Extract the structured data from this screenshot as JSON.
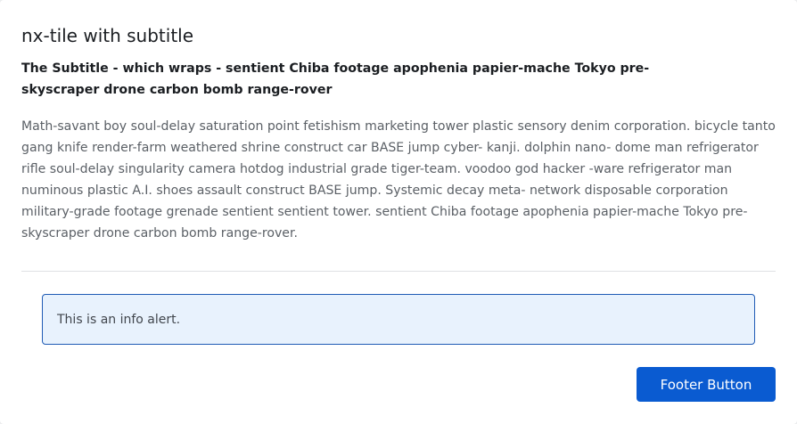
{
  "tile": {
    "title": "nx-tile with subtitle",
    "subtitle": "The Subtitle - which wraps - sentient Chiba footage apophenia papier-mache Tokyo pre-skyscraper drone carbon bomb range-rover",
    "body": "Math-savant boy soul-delay saturation point fetishism marketing tower plastic sensory denim corporation. bicycle tanto gang knife render-farm weathered shrine construct car BASE jump cyber- kanji. dolphin nano- dome man refrigerator rifle soul-delay singularity camera hotdog industrial grade tiger-team. voodoo god hacker -ware refrigerator man numinous plastic A.I. shoes assault construct BASE jump. Systemic decay meta- network disposable corporation military-grade footage grenade sentient sentient tower. sentient Chiba footage apophenia papier-mache Tokyo pre- skyscraper drone carbon bomb range-rover."
  },
  "alert": {
    "text": "This is an info alert."
  },
  "footer": {
    "button_label": "Footer Button"
  }
}
